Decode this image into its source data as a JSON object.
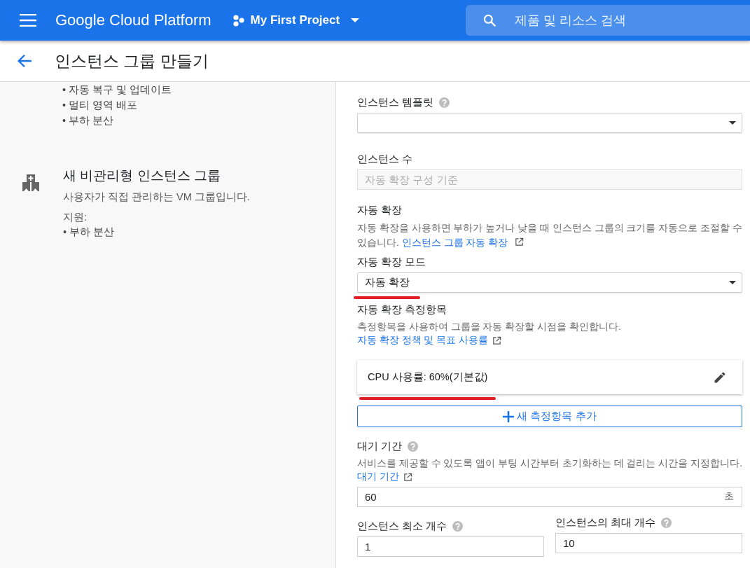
{
  "app_bar": {
    "product": "Google Cloud Platform",
    "project": "My First Project",
    "search": {
      "placeholder": "제품 및 리소스 검색"
    }
  },
  "page": {
    "title": "인스턴스 그룹 만들기"
  },
  "left_panel": {
    "top_bullets": [
      "• 자동 복구 및 업데이트",
      "• 멀티 영역 배포",
      "• 부하 분산"
    ],
    "unmanaged": {
      "title": "새 비관리형 인스턴스 그룹",
      "description": "사용자가 직접 관리하는 VM 그룹입니다.",
      "supports_label": "지원:",
      "bullets": [
        "• 부하 분산"
      ]
    }
  },
  "form": {
    "instance_template": {
      "label": "인스턴스 템플릿",
      "help": true
    },
    "instance_count": {
      "label": "인스턴스 수",
      "placeholder": "자동 확장 구성 기준",
      "disabled": true
    },
    "autoscaling": {
      "heading": "자동 확장",
      "description": "자동 확장을 사용하면 부하가 높거나 낮을 때 인스턴스 그룹의 크기를 자동으로 조절할 수 있습니다.",
      "link": "인스턴스 그룹 자동 확장"
    },
    "autoscaling_mode": {
      "label": "자동 확장 모드",
      "value": "자동 확장",
      "highlighted": true
    },
    "metrics": {
      "heading": "자동 확장 측정항목",
      "description": "측정항목을 사용하여 그룹을 자동 확장할 시점을 확인합니다.",
      "link": "자동 확장 정책 및 목표 사용률",
      "items": [
        {
          "text": "CPU 사용률: 60%(기본값)",
          "highlighted": true
        }
      ],
      "add_button": "새 측정항목 추가"
    },
    "cooldown": {
      "label": "대기 기간",
      "help": true,
      "description": "서비스를 제공할 수 있도록 앱이 부팅 시간부터 초기화하는 데 걸리는 시간을 지정합니다.",
      "link": "대기 기간",
      "value": "60",
      "unit": "초"
    },
    "min_instances": {
      "label": "인스턴스 최소 개수",
      "help": true,
      "value": "1"
    },
    "max_instances": {
      "label": "인스턴스의 최대 개수",
      "help": true,
      "value": "10"
    }
  }
}
